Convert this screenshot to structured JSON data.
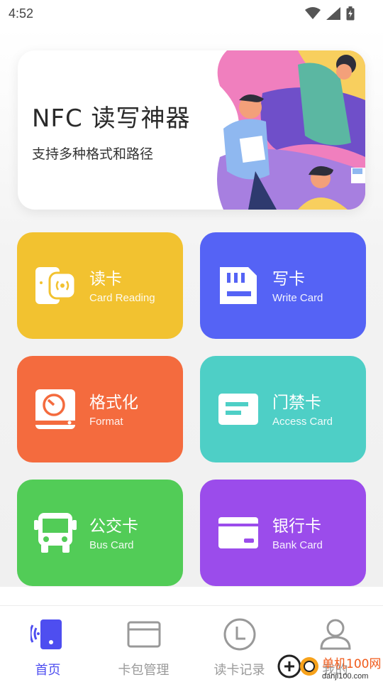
{
  "status_bar": {
    "time": "4:52"
  },
  "banner": {
    "title": "NFC 读写神器",
    "subtitle": "支持多种格式和路径"
  },
  "tiles": [
    {
      "title": "读卡",
      "subtitle": "Card Reading",
      "color": "#F2C230",
      "icon": "card-reader-icon"
    },
    {
      "title": "写卡",
      "subtitle": "Write Card",
      "color": "#5563F5",
      "icon": "sd-card-icon"
    },
    {
      "title": "格式化",
      "subtitle": "Format",
      "color": "#F46B3E",
      "icon": "format-drive-icon"
    },
    {
      "title": "门禁卡",
      "subtitle": "Access Card",
      "color": "#4ECFC6",
      "icon": "access-card-icon"
    },
    {
      "title": "公交卡",
      "subtitle": "Bus Card",
      "color": "#52CC57",
      "icon": "bus-icon"
    },
    {
      "title": "银行卡",
      "subtitle": "Bank Card",
      "color": "#9B4CEB",
      "icon": "bank-card-icon"
    }
  ],
  "bottom_nav": {
    "items": [
      {
        "label": "首页",
        "active": true,
        "icon": "home-nfc-icon"
      },
      {
        "label": "卡包管理",
        "active": false,
        "icon": "wallet-card-icon"
      },
      {
        "label": "读卡记录",
        "active": false,
        "icon": "clock-icon"
      },
      {
        "label": "我的",
        "active": false,
        "icon": "user-icon"
      }
    ]
  },
  "watermark": {
    "text": "单机100网",
    "url_text": "danji100.com"
  },
  "colors": {
    "active_nav": "#4E4EF0",
    "inactive_nav": "#999999"
  }
}
